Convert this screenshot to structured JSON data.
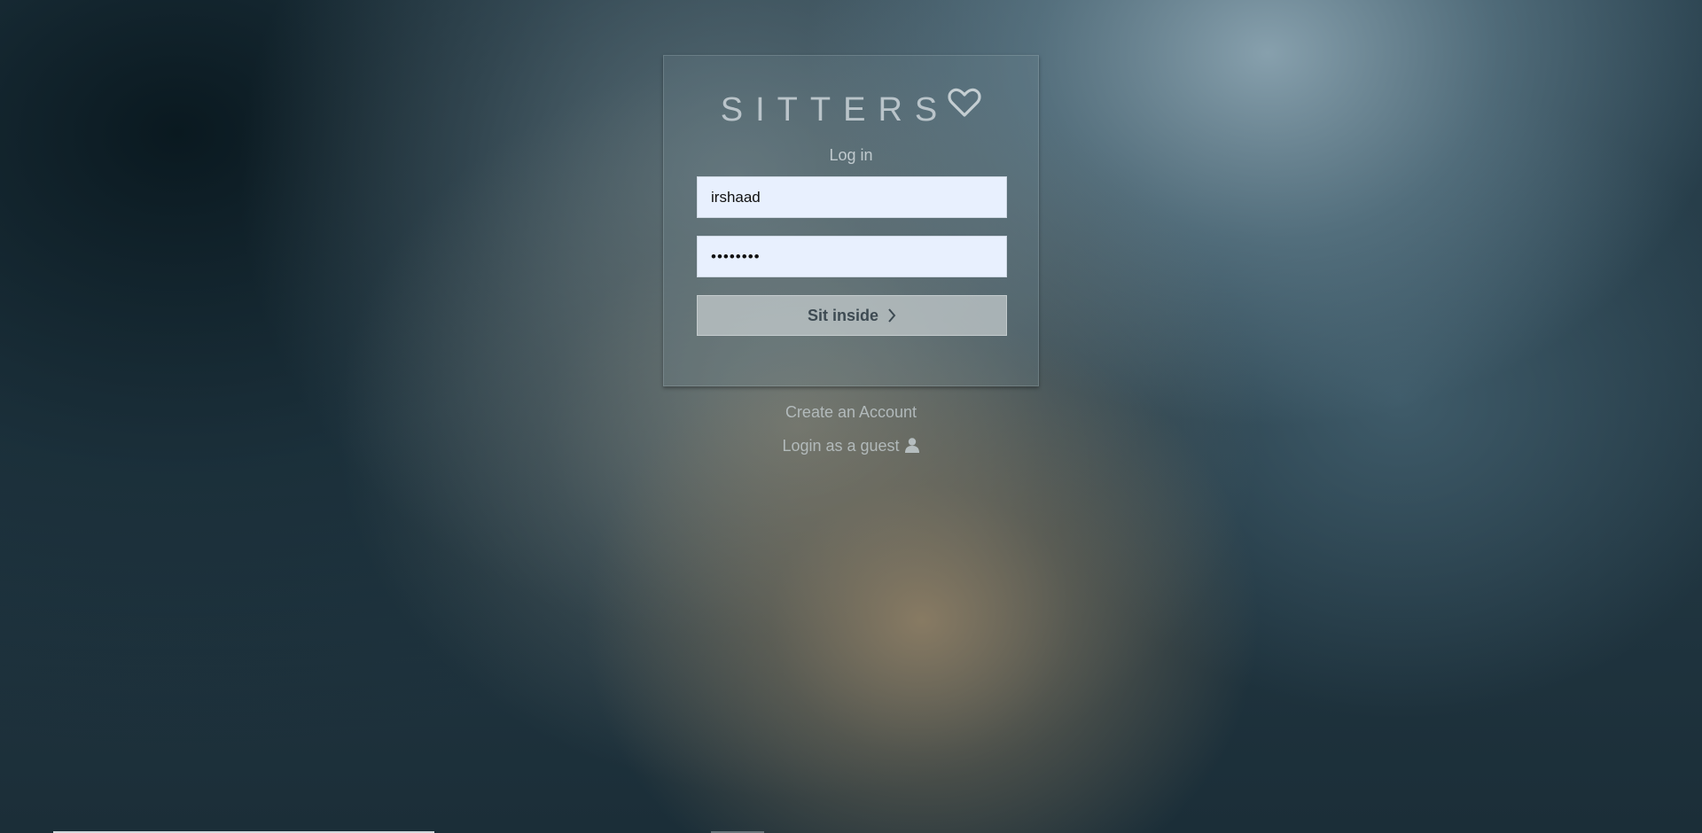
{
  "brand": {
    "name": "SITTERS",
    "icon": "heart-outline-icon"
  },
  "login": {
    "heading": "Log in",
    "username_value": "irshaad",
    "password_value": "••••••••",
    "submit_label": "Sit inside",
    "submit_icon": "chevron-right-icon"
  },
  "links": {
    "create_account": "Create an Account",
    "guest_login": "Login as a guest",
    "guest_icon": "user-icon"
  },
  "colors": {
    "input_background": "#e8f0fe",
    "button_text": "#3d4a52"
  }
}
